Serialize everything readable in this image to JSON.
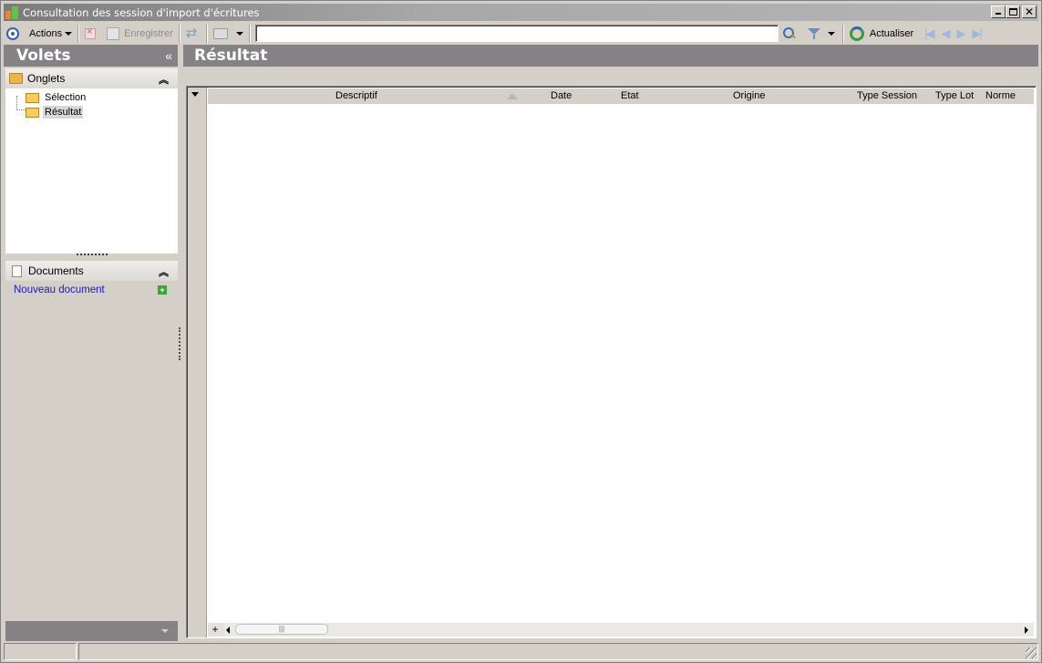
{
  "window": {
    "title": "Consultation des session d'import d'écritures",
    "controls": {
      "minimize": "_",
      "maximize": "□",
      "close": "✕"
    }
  },
  "toolbar": {
    "actions_label": "Actions",
    "save_label": "Enregistrer",
    "search_value": "",
    "refresh_label": "Actualiser"
  },
  "left_panel": {
    "title": "Volets",
    "collapse_glyph": "«",
    "tabs_section": {
      "title": "Onglets",
      "items": [
        {
          "label": "Sélection",
          "selected": false
        },
        {
          "label": "Résultat",
          "selected": true
        }
      ]
    },
    "documents_section": {
      "title": "Documents",
      "new_document_label": "Nouveau document"
    }
  },
  "main": {
    "title": "Résultat",
    "grid": {
      "columns": [
        "Descriptif",
        "Date",
        "Etat",
        "Origine",
        "Type Session",
        "Type Lot",
        "Norme"
      ],
      "rows": [],
      "add_row_glyph": "+",
      "scroll_thumb_glyph": "|||"
    }
  },
  "status_bar": {
    "cells": [
      "",
      ""
    ]
  },
  "icons": {
    "app": "app-icon",
    "actions": "circle-target-icon",
    "delete": "delete-icon",
    "save": "save-icon",
    "sync": "sync-icon",
    "print": "print-icon",
    "search": "magnifier-icon",
    "filter": "funnel-icon",
    "refresh": "refresh-icon",
    "nav": [
      "first-icon",
      "previous-icon",
      "next-icon",
      "last-icon"
    ],
    "folder": "folder-icon",
    "document": "document-icon",
    "add": "plus-icon"
  },
  "colors": {
    "titlebar": "#7b7b7b",
    "panel_header": "#848284",
    "background": "#d4d0c8",
    "link": "#1a1ac8"
  }
}
